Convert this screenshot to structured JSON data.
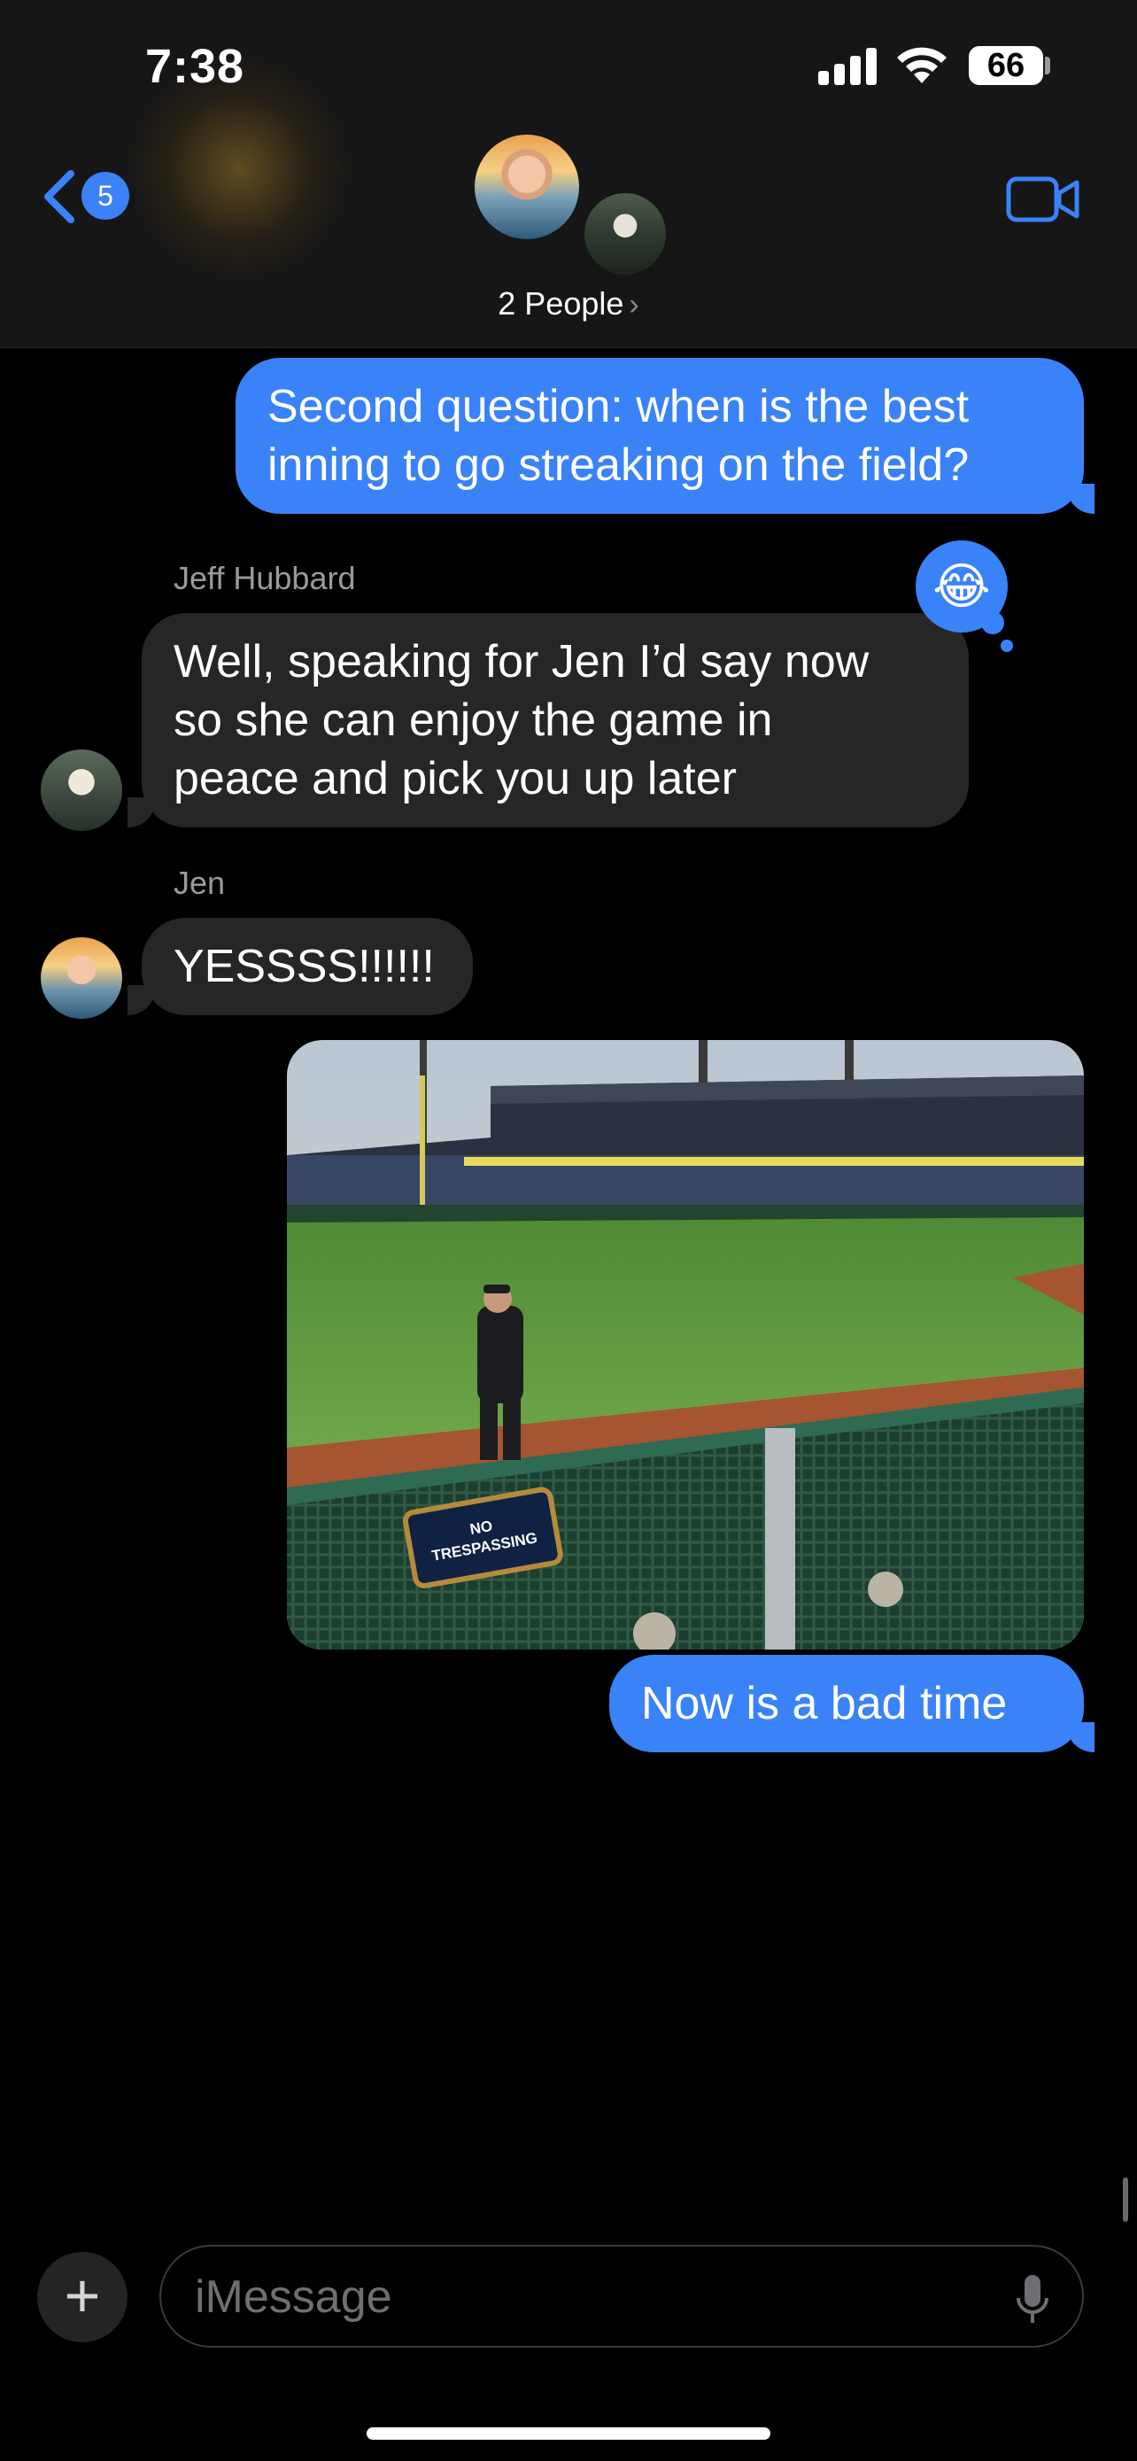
{
  "status_bar": {
    "time": "7:38",
    "battery": "66"
  },
  "header": {
    "back_badge": "5",
    "group_label": "2 People",
    "chevron": "›"
  },
  "messages": [
    {
      "sender": "me",
      "text_line1": "Second question: when is the best",
      "text_line2": "inning to go streaking on the field?"
    },
    {
      "sender": "Jeff Hubbard",
      "text_line1": "Well, speaking for Jen I’d say now",
      "text_line2": "so she can enjoy the game in",
      "text_line3": "peace and pick you up later",
      "tapback": "😂"
    },
    {
      "sender": "Jen",
      "text": "YESSSS!!!!!!"
    },
    {
      "sender": "me",
      "type": "photo",
      "sign_text_line1": "NO",
      "sign_text_line2": "TRESPASSING"
    },
    {
      "sender": "me",
      "text": "Now is a bad time"
    }
  ],
  "composer": {
    "placeholder": "iMessage",
    "plus": "+"
  },
  "colors": {
    "outgoing": "#3a82f7",
    "incoming": "#262628",
    "background": "#000000"
  }
}
